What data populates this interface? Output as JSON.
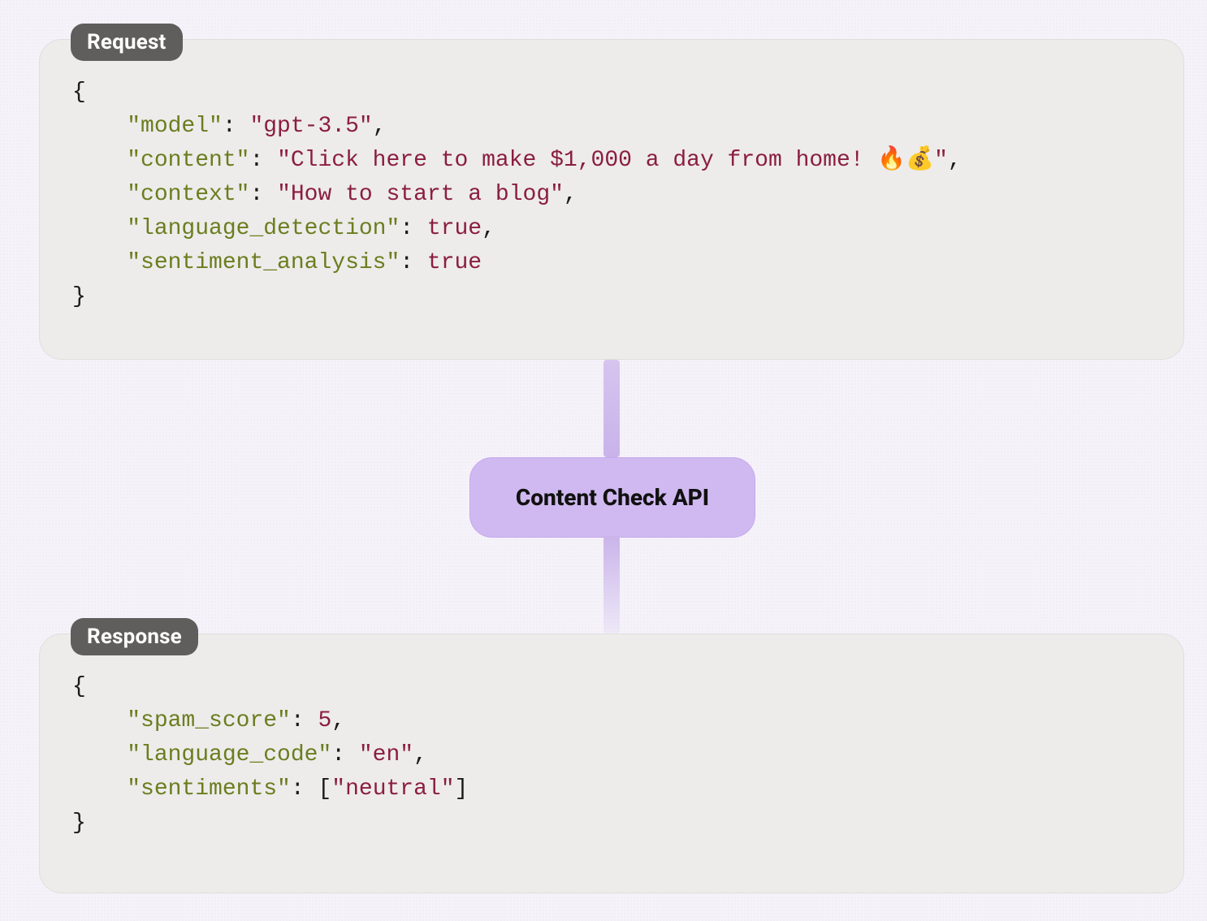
{
  "labels": {
    "request": "Request",
    "response": "Response",
    "api": "Content Check API"
  },
  "request": {
    "model_key": "\"model\"",
    "model_val": "\"gpt-3.5\"",
    "content_key": "\"content\"",
    "content_val": "\"Click here to make $1,000 a day from home! 🔥💰\"",
    "context_key": "\"context\"",
    "context_val": "\"How to start a blog\"",
    "langdet_key": "\"language_detection\"",
    "langdet_val": "true",
    "senti_key": "\"sentiment_analysis\"",
    "senti_val": "true"
  },
  "response": {
    "spam_key": "\"spam_score\"",
    "spam_val": "5",
    "lang_key": "\"language_code\"",
    "lang_val": "\"en\"",
    "senti_key": "\"sentiments\"",
    "senti_val": "\"neutral\""
  }
}
